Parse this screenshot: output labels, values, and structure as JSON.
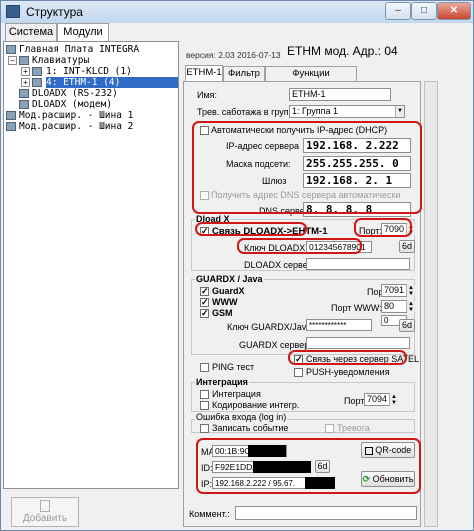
{
  "window": {
    "title": "Структура",
    "min": "–",
    "max": "□",
    "close": "✕"
  },
  "left_tabs": [
    "Система",
    "Модули"
  ],
  "tree": [
    {
      "text": "Главная Плата INTEGRA"
    },
    {
      "text": "Клавиатуры"
    },
    {
      "text": "1: INT-KLCD   (1)"
    },
    {
      "text": "4: ETHM-1     (4)"
    },
    {
      "text": "DLOADX (RS-232)"
    },
    {
      "text": "DLOADX (модем)"
    },
    {
      "text": "Мод.расшир. - Шина 1"
    },
    {
      "text": "Мод.расшир. - Шина 2"
    }
  ],
  "add_button": "Добавить",
  "header": {
    "version": "версия: 2.03 2016-07-13",
    "title": "ETHM мод. Адр.: 04"
  },
  "right_tabs": [
    "ETHM-1",
    "Фильтр IP",
    "Функции пользователя"
  ],
  "general": {
    "name_label": "Имя:",
    "name_value": "ETHM-1",
    "alarm_label": "Трев. саботажа в группе:",
    "alarm_value": "1: Группа 1"
  },
  "network": {
    "dhcp_label": "Автоматически получить IP-адрес (DHCP)",
    "ip_label": "IP-адрес сервера",
    "ip_value": "192.168. 2.222",
    "mask_label": "Маска подсети:",
    "mask_value": "255.255.255. 0",
    "gw_label": "Шлюз",
    "gw_value": "192.168. 2. 1",
    "dns_auto_label": "Получить адрес DNS сервера автоматически",
    "dns_label": "DNS сервер:",
    "dns_value": "8. 8. 8. 8"
  },
  "dloadx": {
    "group": "Dload X",
    "link_label": "Связь DLOADX->EHTM-1",
    "port_label": "Порт:",
    "port_value": "7090",
    "key_label": "Ключ DLOADX:",
    "key_value": "012345678901",
    "server_label": "DLOADX сервер:",
    "gen": "6d"
  },
  "guardx": {
    "group": "GUARDX / Java",
    "port_label": "Порт:",
    "port_value": "7091",
    "www_port_label": "Порт WWW:",
    "www_port_value": "80",
    "gsm_port_value": "0",
    "items": [
      "GuardX",
      "WWW",
      "GSM"
    ],
    "key_label": "Ключ GUARDX/Java:",
    "key_value": "************",
    "server_label": "GUARDX сервер:",
    "gen": "6d"
  },
  "ping_label": "PING тест",
  "satel_label": "Связь через сервер SATEL",
  "push_label": "PUSH-уведомления",
  "integration": {
    "group": "Интеграция",
    "item1": "Интеграция",
    "item2": "Кодирование интегр.",
    "port_label": "Порт:",
    "port_value": "7094"
  },
  "login_error": {
    "group": "Ошибка входа (log in)",
    "record": "Записать событие",
    "alarm": "Тревога"
  },
  "device": {
    "mac_label": "MAC:",
    "mac_value": "00:1B:9C:",
    "id_label": "ID:",
    "id_value": "F92E1DDA",
    "ip_label": "IP:",
    "ip_value": "192.168.2.222 / 95.67.",
    "qr_label": "QR-code",
    "refresh_label": "Обновить",
    "gen": "6d"
  },
  "comment_label": "Коммент.:",
  "colors": {
    "highlight": "#d21616",
    "selection": "#2f6bc7"
  }
}
